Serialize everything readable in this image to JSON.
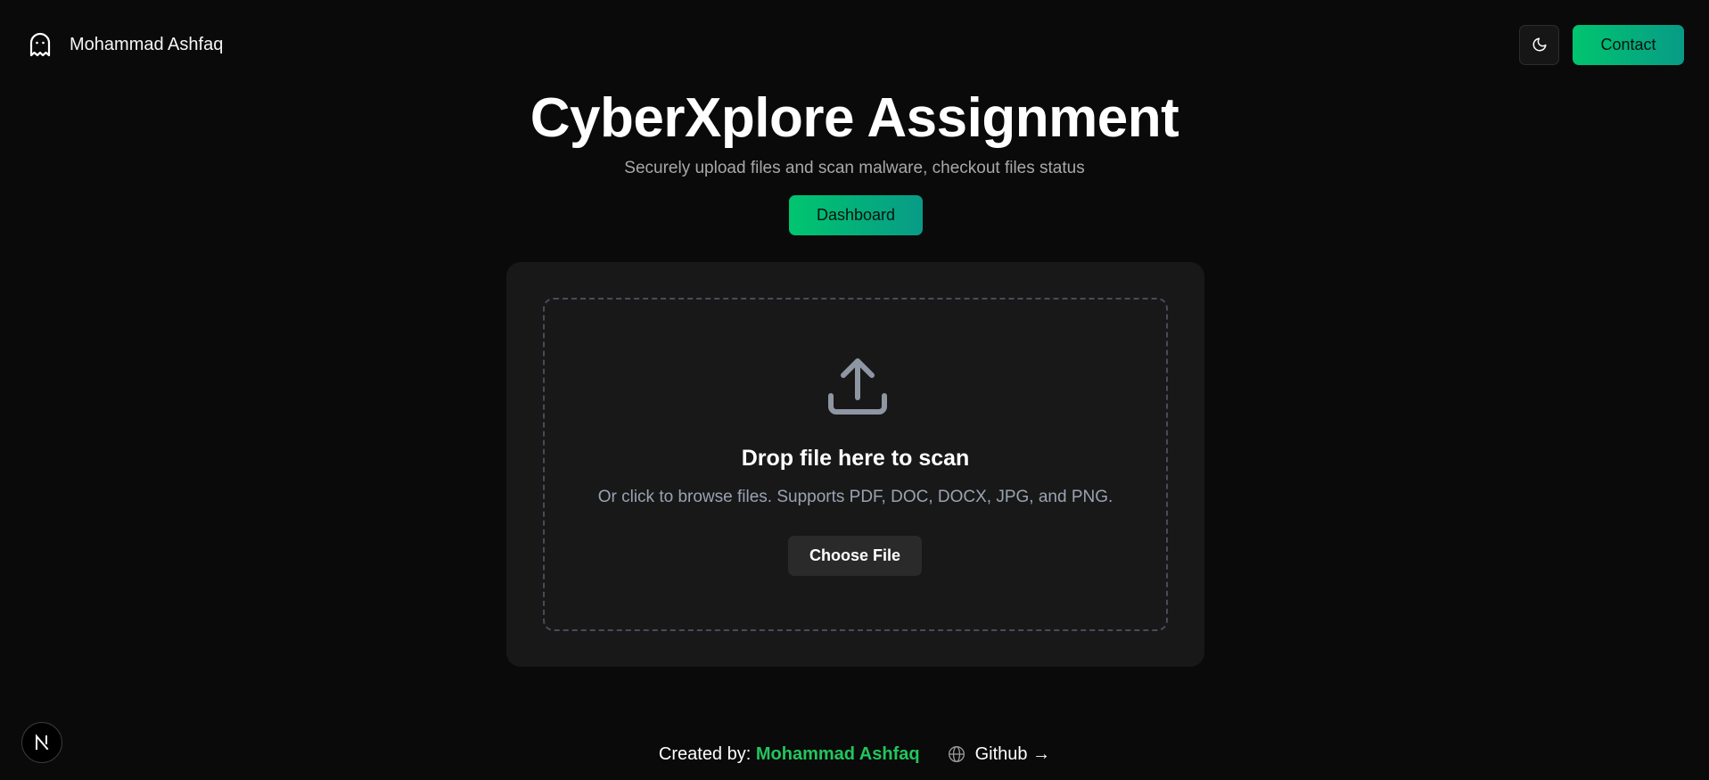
{
  "header": {
    "brand_name": "Mohammad Ashfaq",
    "brand_icon": "ghost-icon",
    "theme_toggle_icon": "moon-icon",
    "contact_label": "Contact"
  },
  "hero": {
    "title": "CyberXplore Assignment",
    "subtitle": "Securely upload files and scan malware, checkout files status",
    "dashboard_label": "Dashboard"
  },
  "upload": {
    "icon": "upload-icon",
    "title": "Drop file here to scan",
    "subtitle": "Or click to browse files. Supports PDF, DOC, DOCX, JPG, and PNG.",
    "button_label": "Choose File"
  },
  "footer": {
    "created_by_label": "Created by:",
    "author_name": "Mohammad Ashfaq",
    "github_label": "Github →",
    "github_icon": "globe-icon"
  },
  "badge": {
    "letter": "N"
  },
  "colors": {
    "background": "#0a0a0a",
    "card": "#181818",
    "accent_start": "#00c56e",
    "accent_end": "#089b87",
    "author_green": "#22c55e"
  }
}
